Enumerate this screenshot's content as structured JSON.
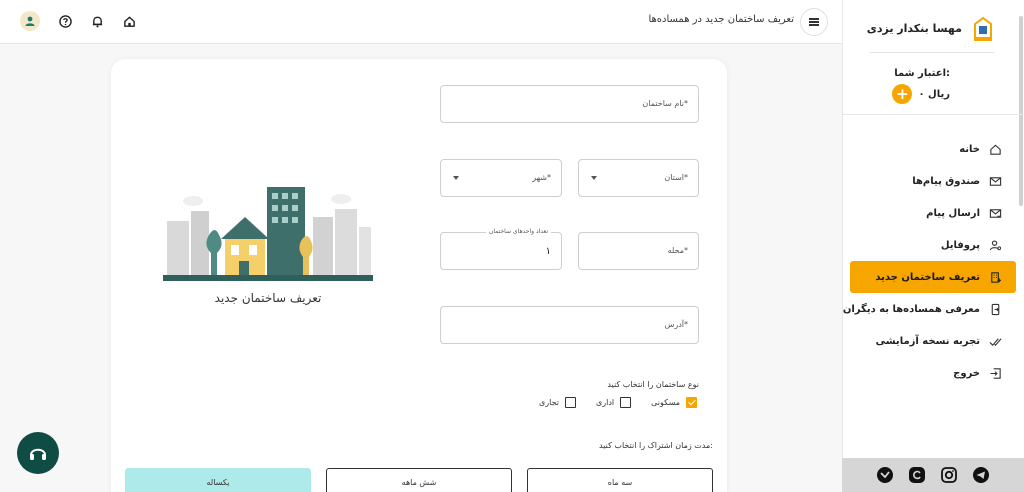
{
  "header": {
    "page_title": "تعریف ساختمان جدید در همساده‌ها"
  },
  "sidebar": {
    "user_name": "مهسا بنکدار یزدی",
    "credit_label": "اعتبار شما:",
    "credit_value": "۰ ریال",
    "add_credit_symbol": "+",
    "items": [
      {
        "label": "خانه",
        "icon": "home-icon"
      },
      {
        "label": "صندوق پیام‌ها",
        "icon": "mail-icon"
      },
      {
        "label": "ارسال پیام",
        "icon": "send-mail-icon"
      },
      {
        "label": "پروفایل",
        "icon": "user-settings-icon"
      },
      {
        "label": "تعریف ساختمان جدید",
        "icon": "building-add-icon",
        "active": true
      },
      {
        "label": "معرفی همساده‌ها به دیگران",
        "icon": "share-device-icon"
      },
      {
        "label": "تجربه نسخه آزمایشی",
        "icon": "double-check-icon"
      },
      {
        "label": "خروج",
        "icon": "logout-icon"
      }
    ],
    "social": [
      "telegram-icon",
      "instagram-icon",
      "eitaa-icon",
      "bale-icon"
    ]
  },
  "form": {
    "building_name_placeholder": "نام ساختمان*",
    "province_placeholder": "استان*",
    "city_placeholder": "شهر*",
    "neighborhood_placeholder": "محله*",
    "units_label": "تعداد واحدهای ساختمان",
    "units_value": "۱",
    "address_placeholder": "آدرس*",
    "building_type_label": "نوع ساختمان را انتخاب کنید",
    "building_types": [
      {
        "label": "مسکونی",
        "checked": true
      },
      {
        "label": "اداری",
        "checked": false
      },
      {
        "label": "تجاری",
        "checked": false
      }
    ],
    "subscription_label": "مدت زمان اشتراک را انتخاب کنید:",
    "durations": [
      {
        "label": "سه ماه",
        "selected": false
      },
      {
        "label": "شش ماهه",
        "selected": false
      },
      {
        "label": "یکساله",
        "selected": true
      }
    ]
  },
  "illustration": {
    "caption": "تعریف ساختمان جدید"
  },
  "colors": {
    "accent": "#f7a600",
    "selected_duration": "#aeeaea",
    "support_button": "#0f4d44"
  }
}
